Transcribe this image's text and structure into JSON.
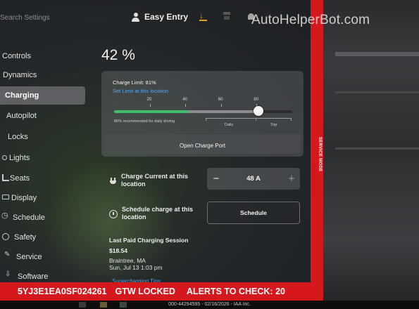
{
  "top_bar": {
    "search_placeholder": "Search Settings",
    "profile_name": "Easy Entry",
    "icons": [
      "profile-icon",
      "download-icon",
      "garage-icon",
      "bell-icon"
    ],
    "download_icon_color": "#e8a11c"
  },
  "sidebar": {
    "items": [
      {
        "label": "Controls",
        "icon": "none"
      },
      {
        "label": "Dynamics",
        "icon": "none"
      },
      {
        "label": "Charging",
        "icon": "none",
        "active": true
      },
      {
        "label": "Autopilot",
        "icon": "none"
      },
      {
        "label": "Locks",
        "icon": "none"
      },
      {
        "label": "Lights",
        "icon": "light-icon"
      },
      {
        "label": "Seats",
        "icon": "seat-icon"
      },
      {
        "label": "Display",
        "icon": "display-icon"
      },
      {
        "label": "Schedule",
        "icon": "alarm-icon"
      },
      {
        "label": "Safety",
        "icon": "safety-icon"
      },
      {
        "label": "Service",
        "icon": "wrench-icon"
      },
      {
        "label": "Software",
        "icon": "download-icon"
      }
    ]
  },
  "battery": {
    "percent_label": "42 %"
  },
  "charge_limit": {
    "title": "Charge Limit: 81%",
    "set_limit_link": "Set Limit at this location",
    "ticks": [
      "20",
      "40",
      "60",
      "80"
    ],
    "value_percent": 81,
    "current_charge_percent": 42,
    "recommendation": "80% recommended for daily driving",
    "daily_label": "Daily",
    "trip_label": "Trip",
    "green_color": "#3fbf6a",
    "open_port_label": "Open Charge Port"
  },
  "charge_current": {
    "label": "Charge Current at this location",
    "minus": "−",
    "value": "48 A",
    "plus": "+"
  },
  "schedule": {
    "label": "Schedule charge at this location",
    "button": "Schedule"
  },
  "last_session": {
    "title": "Last Paid Charging Session",
    "amount": "$18.54",
    "location": "Braintree, MA",
    "when": "Sun, Jul 13 1:03 pm",
    "tips_link": "Supercharging Tips"
  },
  "service_banner": {
    "vin": "5YJ3E1EA0SF024261",
    "gtw": "GTW LOCKED",
    "alerts": "ALERTS TO CHECK: 20",
    "side_label": "SERVICE MODE",
    "color": "#d4181e"
  },
  "watermark": "AutoHelperBot.com",
  "footer_caption": "000-44294595 - 02/16/2026 - IAA Inc."
}
